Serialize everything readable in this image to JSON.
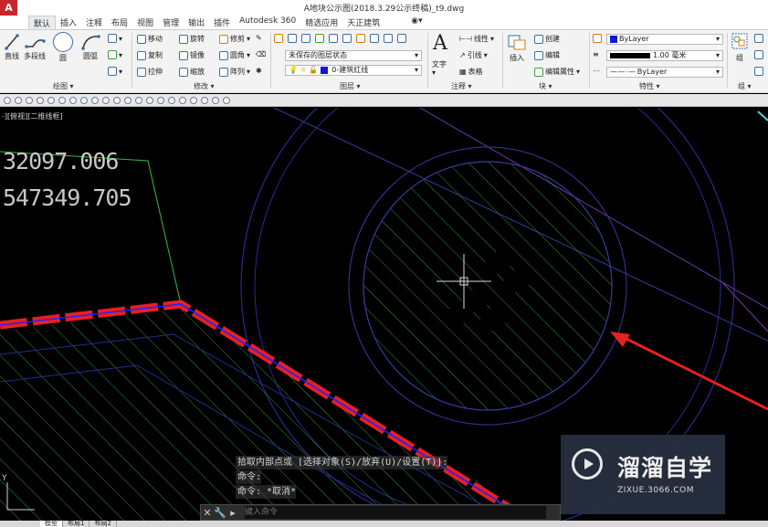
{
  "title": "A地块公示图(2018.3.29公示终稿)_t9.dwg",
  "app_logo": "A",
  "ribbon_tabs": [
    {
      "label": "默认",
      "active": true
    },
    {
      "label": "插入"
    },
    {
      "label": "注释"
    },
    {
      "label": "布局"
    },
    {
      "label": "视图"
    },
    {
      "label": "管理"
    },
    {
      "label": "输出"
    },
    {
      "label": "插件"
    },
    {
      "label": "Autodesk 360"
    },
    {
      "label": "精选应用"
    },
    {
      "label": "天正建筑"
    }
  ],
  "ribbon": {
    "draw": {
      "line": "直线",
      "polyline": "多段线",
      "circle": "圆",
      "arc": "圆弧",
      "panel_label": "绘图"
    },
    "modify": {
      "move": "移动",
      "rotate": "旋转",
      "trim": "修剪",
      "copy": "复制",
      "mirror": "镜像",
      "fillet": "圆角",
      "stretch": "拉伸",
      "scale": "缩放",
      "array": "阵列",
      "panel_label": "修改"
    },
    "layers": {
      "state": "未保存的图层状态",
      "current_layer": "0-建筑红线",
      "panel_label": "图层"
    },
    "annotation": {
      "text": "文字",
      "linear": "线性",
      "leader": "引线",
      "table": "表格",
      "panel_label": "注释"
    },
    "block": {
      "insert": "插入",
      "create": "创建",
      "edit": "编辑",
      "edit_attributes": "编辑属性",
      "panel_label": "块"
    },
    "properties": {
      "color": "ByLayer",
      "lineweight": "1.00 毫米",
      "linetype": "ByLayer",
      "panel_label": "特性"
    },
    "group": {
      "group": "组",
      "panel_label": "组"
    }
  },
  "viewport_label": "-][俯视][二维线框]",
  "coordinates": [
    "32097.006",
    "547349.705"
  ],
  "command": {
    "history": [
      "拾取内部点或 [选择对象(S)/放弃(U)/设置(T)]:",
      "命令:",
      "命令: *取消*"
    ],
    "placeholder": "键入命令",
    "close_glyph": "✕",
    "wrench_glyph": "🔧"
  },
  "layout_tabs": [
    {
      "label": "模型",
      "active": true
    },
    {
      "label": "布局1"
    },
    {
      "label": "布局2"
    }
  ],
  "watermark": {
    "title": "溜溜自学",
    "subtitle": "ZIXUE.3066.COM"
  },
  "colors": {
    "red_line": "#e8201e",
    "blue_line": "#2222ff",
    "hatch_green": "#3cb84a",
    "circle_navy": "#3a3aa0",
    "cursor": "#dddddd"
  }
}
